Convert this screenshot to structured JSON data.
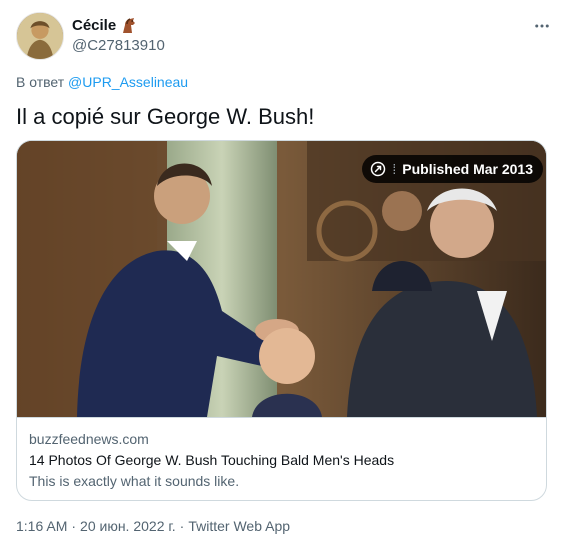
{
  "author": {
    "display_name": "Cécile",
    "handle": "@C27813910",
    "name_emoji": "horse-emoji",
    "avatar": "profile-avatar"
  },
  "reply": {
    "prefix": "В ответ",
    "mention": "@UPR_Asselineau"
  },
  "tweet": {
    "text": "Il a copié sur George W. Bush!"
  },
  "card": {
    "badge_text": "Published Mar 2013",
    "badge_icon": "published-icon",
    "domain": "buzzfeednews.com",
    "title": "14 Photos Of George W. Bush Touching Bald Men's Heads",
    "description": "This is exactly what it sounds like."
  },
  "meta": {
    "time": "1:16 AM",
    "dot1": "·",
    "date": "20 июн. 2022 г.",
    "dot2": "·",
    "source": "Twitter Web App"
  },
  "colors": {
    "link": "#1d9bf0",
    "secondary_text": "#536471",
    "primary_text": "#0f1419",
    "border": "#cfd9de"
  }
}
